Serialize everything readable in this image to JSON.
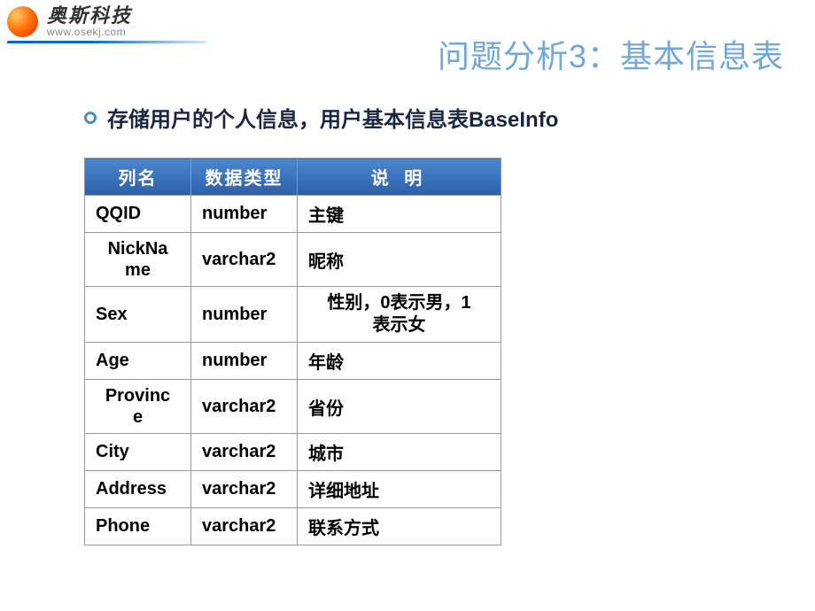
{
  "logo": {
    "title": "奥斯科技",
    "url": "www.osekj.com"
  },
  "slide_title": "问题分析3：基本信息表",
  "bullet_text": "存储用户的个人信息，用户基本信息表BaseInfo",
  "table": {
    "headers": {
      "col_name": "列名",
      "col_type": "数据类型",
      "col_desc": "说 明"
    },
    "rows": [
      {
        "name": "QQID",
        "type": "number",
        "desc": "主键",
        "name_wrap": false,
        "desc_center": false
      },
      {
        "name": "NickNa\nme",
        "type": "varchar2",
        "desc": "昵称",
        "name_wrap": true,
        "desc_center": false
      },
      {
        "name": "Sex",
        "type": "number",
        "desc": "性别，0表示男，1\n表示女",
        "name_wrap": false,
        "desc_center": true
      },
      {
        "name": "Age",
        "type": "number",
        "desc": "年龄",
        "name_wrap": false,
        "desc_center": false
      },
      {
        "name": "Provinc\ne",
        "type": "varchar2",
        "desc": "省份",
        "name_wrap": true,
        "desc_center": false
      },
      {
        "name": "City",
        "type": "varchar2",
        "desc": "城市",
        "name_wrap": false,
        "desc_center": false
      },
      {
        "name": "Address",
        "type": "varchar2",
        "desc": "详细地址",
        "name_wrap": false,
        "desc_center": false
      },
      {
        "name": "Phone",
        "type": "varchar2",
        "desc": "联系方式",
        "name_wrap": false,
        "desc_center": false
      }
    ]
  }
}
